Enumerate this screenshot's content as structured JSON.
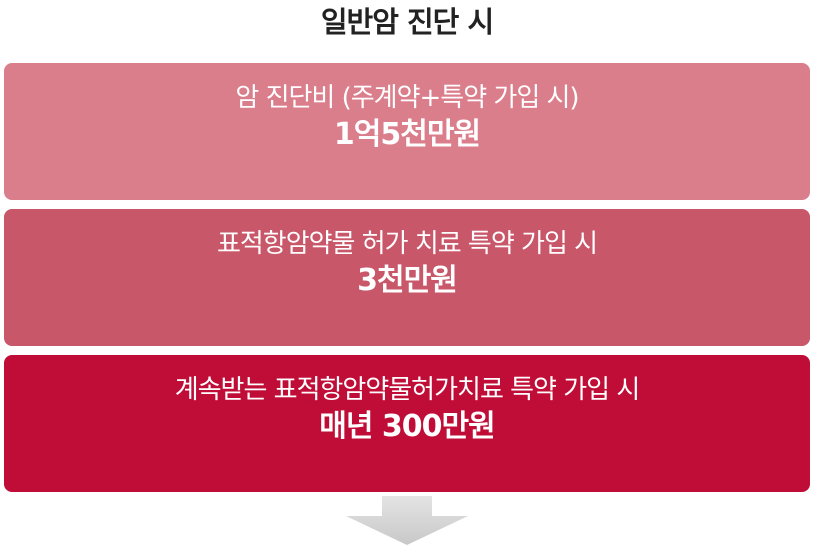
{
  "title": "일반암 진단 시",
  "colors": {
    "box1": "#db7e8c",
    "box2": "#c9576a",
    "box3": "#c00d37",
    "arrow_light": "#e4e4e4",
    "arrow_dark": "#c8c8c8"
  },
  "boxes": [
    {
      "condition": "암 진단비 (주계약+특약 가입 시)",
      "amount": "1억5천만원"
    },
    {
      "condition": "표적항암약물 허가 치료 특약 가입 시",
      "amount": "3천만원"
    },
    {
      "condition": "계속받는 표적항암약물허가치료 특약 가입 시",
      "amount": "매년 300만원"
    }
  ],
  "arrow_icon": "down-arrow-icon"
}
